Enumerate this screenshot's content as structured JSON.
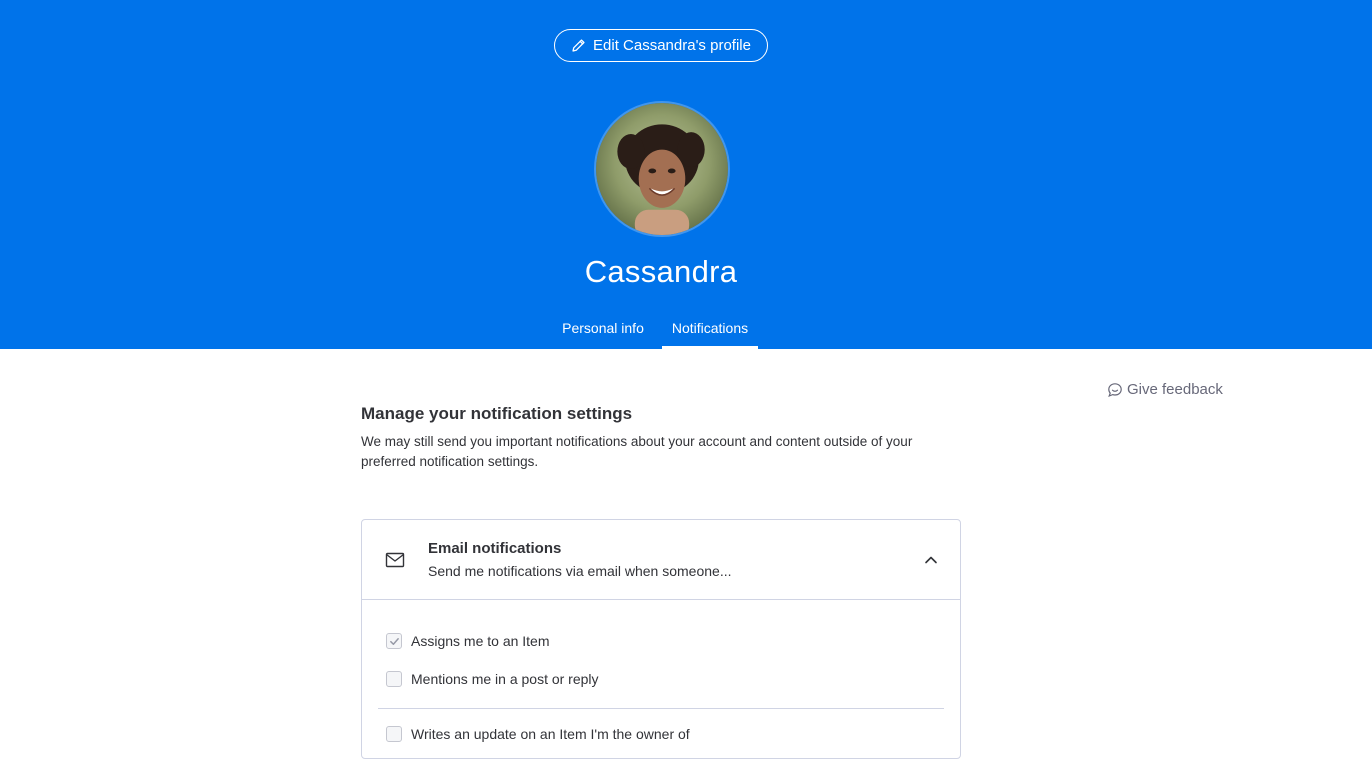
{
  "colors": {
    "brand": "#0073ea",
    "text": "#323338",
    "muted": "#676879",
    "border": "#d0d4e4"
  },
  "profile": {
    "edit_label": "Edit Cassandra's profile",
    "name": "Cassandra"
  },
  "tabs": [
    {
      "label": "Personal info",
      "active": false
    },
    {
      "label": "Notifications",
      "active": true
    }
  ],
  "feedback": {
    "label": "Give feedback",
    "icon": "chat-bubble-icon"
  },
  "settings": {
    "title": "Manage your notification settings",
    "description": "We may still send you important notifications about your account and content outside of your preferred notification settings."
  },
  "email_card": {
    "icon": "mail-icon",
    "title": "Email notifications",
    "subtitle": "Send me notifications via email when someone...",
    "expanded": true,
    "options": [
      {
        "label": "Assigns me to an Item",
        "checked": true
      },
      {
        "label": "Mentions me in a post or reply",
        "checked": false
      },
      {
        "label": "Writes an update on an Item I'm the owner of",
        "checked": false
      }
    ]
  }
}
